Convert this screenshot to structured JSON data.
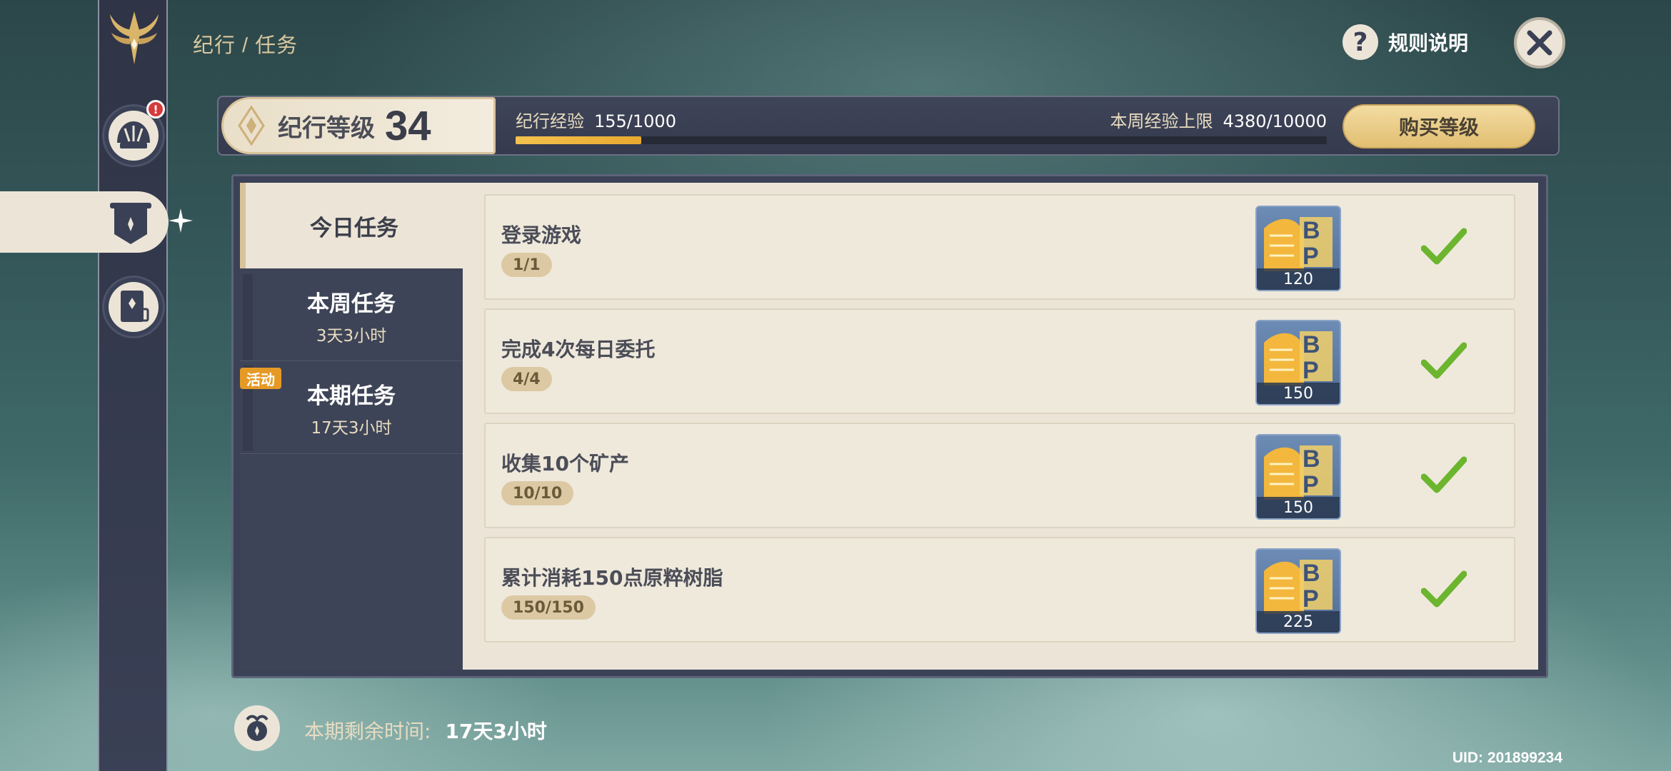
{
  "header": {
    "breadcrumb": "纪行 / 任务",
    "rules_label": "规则说明"
  },
  "level": {
    "label": "纪行等级",
    "value": "34",
    "exp_label": "纪行经验",
    "exp_value": "155/1000",
    "exp_fraction": 0.155,
    "weekly_label": "本周经验上限",
    "weekly_value": "4380/10000",
    "buy_label": "购买等级"
  },
  "tabs": [
    {
      "label": "今日任务",
      "sub": "",
      "active": true
    },
    {
      "label": "本周任务",
      "sub": "3天3小时",
      "active": false
    },
    {
      "label": "本期任务",
      "sub": "17天3小时",
      "active": false,
      "tag": "活动"
    }
  ],
  "tasks": [
    {
      "name": "登录游戏",
      "progress": "1/1",
      "reward": "120",
      "done": true
    },
    {
      "name": "完成4次每日委托",
      "progress": "4/4",
      "reward": "150",
      "done": true
    },
    {
      "name": "收集10个矿产",
      "progress": "10/10",
      "reward": "150",
      "done": true
    },
    {
      "name": "累计消耗150点原粹树脂",
      "progress": "150/150",
      "reward": "225",
      "done": true
    }
  ],
  "footer": {
    "remaining_label": "本期剩余时间:",
    "remaining_value": "17天3小时",
    "uid": "UID: 201899234"
  },
  "icons": {
    "logo": "winged-star-logo-icon",
    "nav_1": "shell-icon",
    "nav_2": "banner-icon",
    "nav_3": "book-icon",
    "help": "question-icon",
    "close": "close-icon",
    "check": "checkmark-icon",
    "reward": "bp-exp-icon"
  },
  "colors": {
    "accent_gold": "#e8a930",
    "check_green": "#6cb52e",
    "panel_cream": "#ece5d7",
    "panel_dark": "#3e4457",
    "event_orange": "#e59a26"
  }
}
